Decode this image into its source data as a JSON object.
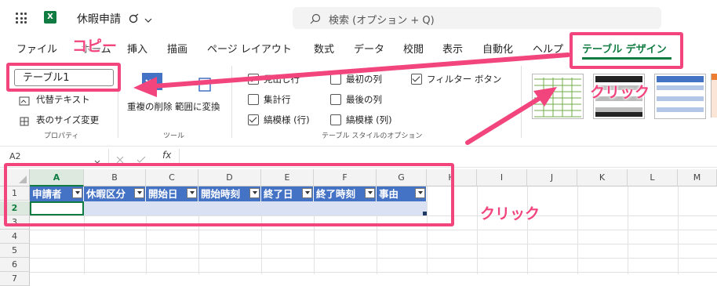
{
  "titlebar": {
    "filename": "休暇申請",
    "search_placeholder": "検索 (オプション + Q)",
    "app_glyph": "X"
  },
  "tabs": [
    "ファイル",
    "ホーム",
    "挿入",
    "描画",
    "ページ レイアウト",
    "数式",
    "データ",
    "校閲",
    "表示",
    "自動化",
    "ヘルプ",
    "テーブル デザイン"
  ],
  "ribbon": {
    "table_name": "テーブル1",
    "alt_text": "代替テキスト",
    "resize_table": "表のサイズ変更",
    "group_properties": "プロパティ",
    "remove_duplicates": "重複の削除",
    "convert_to_range": "範囲に変換",
    "group_tools": "ツール",
    "options": {
      "header_row": "見出し行",
      "total_row": "集計行",
      "banded_rows": "縞模様 (行)",
      "first_column": "最初の列",
      "last_column": "最後の列",
      "banded_columns": "縞模様 (列)",
      "filter_button": "フィルター ボタン"
    },
    "group_style_options": "テーブル スタイルのオプション"
  },
  "formula_bar": {
    "cell_ref": "A2",
    "fx": "fx"
  },
  "grid": {
    "columns": [
      "A",
      "B",
      "C",
      "D",
      "E",
      "F",
      "G",
      "H",
      "I",
      "J",
      "K",
      "L",
      "M"
    ],
    "rows": [
      "1",
      "2",
      "3",
      "4",
      "5",
      "6",
      "7"
    ],
    "headers": [
      "申請者",
      "休暇区分",
      "開始日",
      "開始時刻",
      "終了日",
      "終了時刻",
      "事由"
    ]
  },
  "annotations": {
    "copy_label": "コピー",
    "click_label_1": "クリック",
    "click_label_2": "クリック",
    "color": "#f2457d"
  }
}
